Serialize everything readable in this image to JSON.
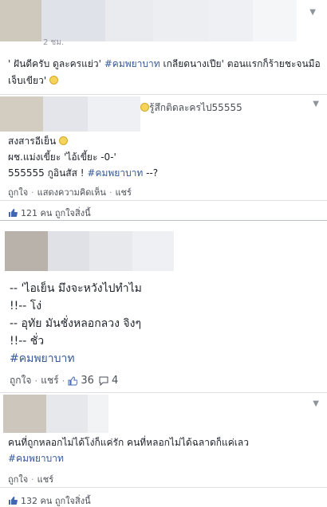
{
  "card1": {
    "partial_meta": "2 ชม.",
    "text_part1": "' ฝันดีครับ ดูละครแย่ว' ",
    "hashtag": "#คมพยาบาท",
    "text_part2": " เกลียดนางเปีย' ตอนแรกก็ร้ายชะจนมือ",
    "text_line2": "เจ็บเขียว'"
  },
  "card2": {
    "header_text": "รู้สึกติดละครไป55555",
    "line1": "สงสารอีเย็น",
    "line2": "ผช.แม่งเขี้ยะ 'ไอ้เขี้ยะ -0-'",
    "line3_part1": "555555 กูอินสัส ! ",
    "hashtag": "#คมพยาบาท",
    "line3_part2": " --?",
    "like_action": "ถูกใจ",
    "comment_action": "แสดงความคิดเห็น",
    "share_action": "แชร์",
    "likes_count": "121 คน ถูกใจสิ่งนี้"
  },
  "card3": {
    "line1": "-- 'ไอเย็น มึงจะหวังไปทำไม",
    "line2": "!!-- โง่",
    "line3": "-- อุทัย มันชั่งหลอกลวง จิงๆ",
    "line4": "!!-- ชั่ว",
    "hashtag": "#คมพยาบาท",
    "like_action": "ถูกใจ",
    "share_action": "แชร์",
    "likes": "36",
    "comments": "4"
  },
  "card4": {
    "line1": "คนที่ถูกหลอกไม่ได้โง่ก็แค่รัก คนที่หลอกไม่ได้ฉลาดก็แค่เลว",
    "hashtag": "#คมพยาบาท",
    "like_action": "ถูกใจ",
    "share_action": "แชร์",
    "likes_count": "132 คน ถูกใจสิ่งนี้"
  },
  "colors": {
    "hashtag": "#365899",
    "meta": "#4b4f56",
    "divider": "#dddfe2"
  }
}
